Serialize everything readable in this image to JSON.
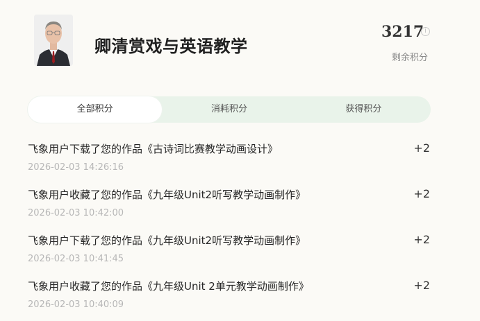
{
  "profile": {
    "name": "卿清赏戏与英语教学",
    "points": "3217",
    "points_label": "剩余积分",
    "info_icon": "info-icon"
  },
  "tabs": [
    {
      "label": "全部积分",
      "active": true
    },
    {
      "label": "消耗积分",
      "active": false
    },
    {
      "label": "获得积分",
      "active": false
    }
  ],
  "records": [
    {
      "text": "飞象用户下载了您的作品《古诗词比赛教学动画设计》",
      "time": "2026-02-03 14:26:16",
      "points": "+2"
    },
    {
      "text": "飞象用户收藏了您的作品《九年级Unit2听写教学动画制作》",
      "time": "2026-02-03 10:42:00",
      "points": "+2"
    },
    {
      "text": "飞象用户下载了您的作品《九年级Unit2听写教学动画制作》",
      "time": "2026-02-03 10:41:45",
      "points": "+2"
    },
    {
      "text": "飞象用户收藏了您的作品《九年级Unit 2单元教学动画制作》",
      "time": "2026-02-03 10:40:09",
      "points": "+2"
    }
  ],
  "colors": {
    "background": "#fbfaf6",
    "tab_bar": "#e9f3ea",
    "tab_active": "#ffffff"
  }
}
